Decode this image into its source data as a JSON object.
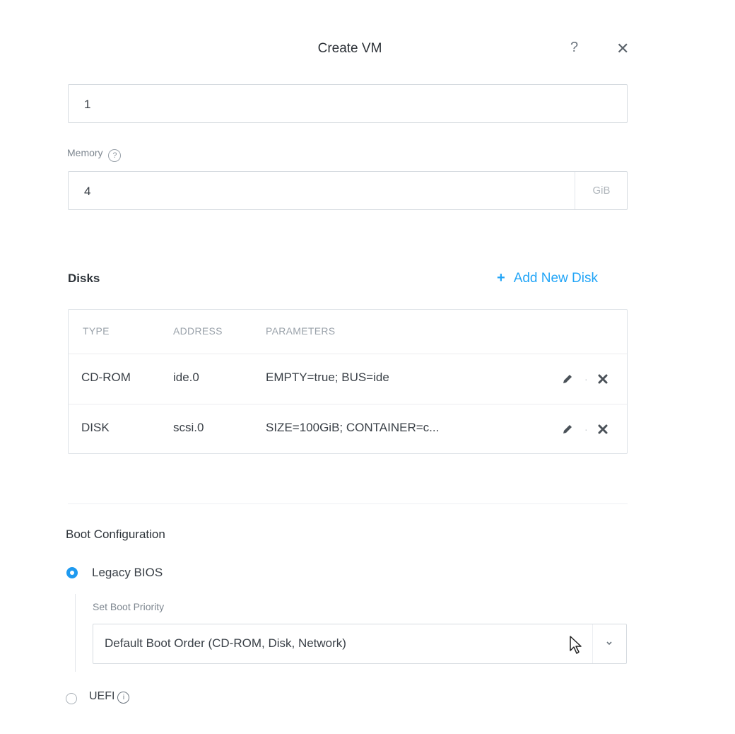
{
  "dialog": {
    "title": "Create VM",
    "help_glyph": "?",
    "close_glyph": "✕"
  },
  "vcpu": {
    "value": "1"
  },
  "memory": {
    "label": "Memory",
    "value": "4",
    "unit": "GiB"
  },
  "disks": {
    "heading": "Disks",
    "add_label": "Add New Disk",
    "add_glyph": "+",
    "columns": [
      "TYPE",
      "ADDRESS",
      "PARAMETERS"
    ],
    "rows": [
      {
        "type": "CD-ROM",
        "address": "ide.0",
        "parameters": "EMPTY=true; BUS=ide"
      },
      {
        "type": "DISK",
        "address": "scsi.0",
        "parameters": "SIZE=100GiB; CONTAINER=c..."
      }
    ]
  },
  "boot": {
    "heading": "Boot Configuration",
    "legacy_label": "Legacy BIOS",
    "priority_label": "Set Boot Priority",
    "priority_value": "Default Boot Order (CD-ROM, Disk, Network)",
    "uefi_label": "UEFI",
    "selected": "legacy"
  },
  "colors": {
    "accent": "#22a5f7",
    "text": "#2d3339",
    "muted": "#9aa2aa",
    "border": "#d6dbe0"
  },
  "icons": {
    "help": "question-icon",
    "close": "close-icon",
    "edit": "pencil-icon",
    "delete": "x-icon",
    "info": "info-icon",
    "dropdown": "chevron-down-icon"
  }
}
